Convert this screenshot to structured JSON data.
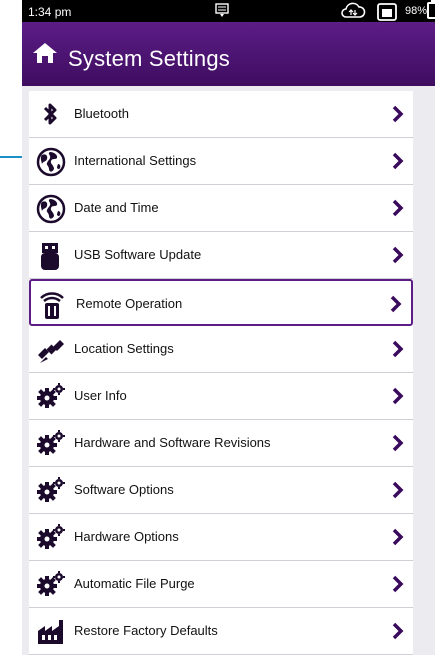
{
  "status_bar": {
    "time": "1:34 pm",
    "battery": "98%",
    "icons": [
      "message-icon",
      "cloud-sync-icon",
      "network-icon",
      "battery-icon"
    ]
  },
  "header": {
    "title": "System Settings",
    "home_icon": "home-icon"
  },
  "colors": {
    "header_purple": "#4a1470",
    "selected_border": "#5c1d86",
    "chevron_purple": "#3a0a5c",
    "callout_blue": "#1a8fc8"
  },
  "menu": {
    "items": [
      {
        "label": "Bluetooth",
        "icon": "bluetooth-icon"
      },
      {
        "label": "International Settings",
        "icon": "globe-icon"
      },
      {
        "label": "Date and Time",
        "icon": "globe-icon"
      },
      {
        "label": "USB Software Update",
        "icon": "usb-drive-icon"
      },
      {
        "label": "Remote Operation",
        "icon": "remote-icon",
        "selected": true
      },
      {
        "label": "Location Settings",
        "icon": "satellite-icon"
      },
      {
        "label": "User Info",
        "icon": "gears-icon"
      },
      {
        "label": "Hardware and Software Revisions",
        "icon": "gears-icon"
      },
      {
        "label": "Software Options",
        "icon": "gears-icon"
      },
      {
        "label": "Hardware Options",
        "icon": "gears-icon"
      },
      {
        "label": "Automatic File Purge",
        "icon": "gears-icon"
      },
      {
        "label": "Restore Factory Defaults",
        "icon": "factory-icon"
      }
    ]
  }
}
